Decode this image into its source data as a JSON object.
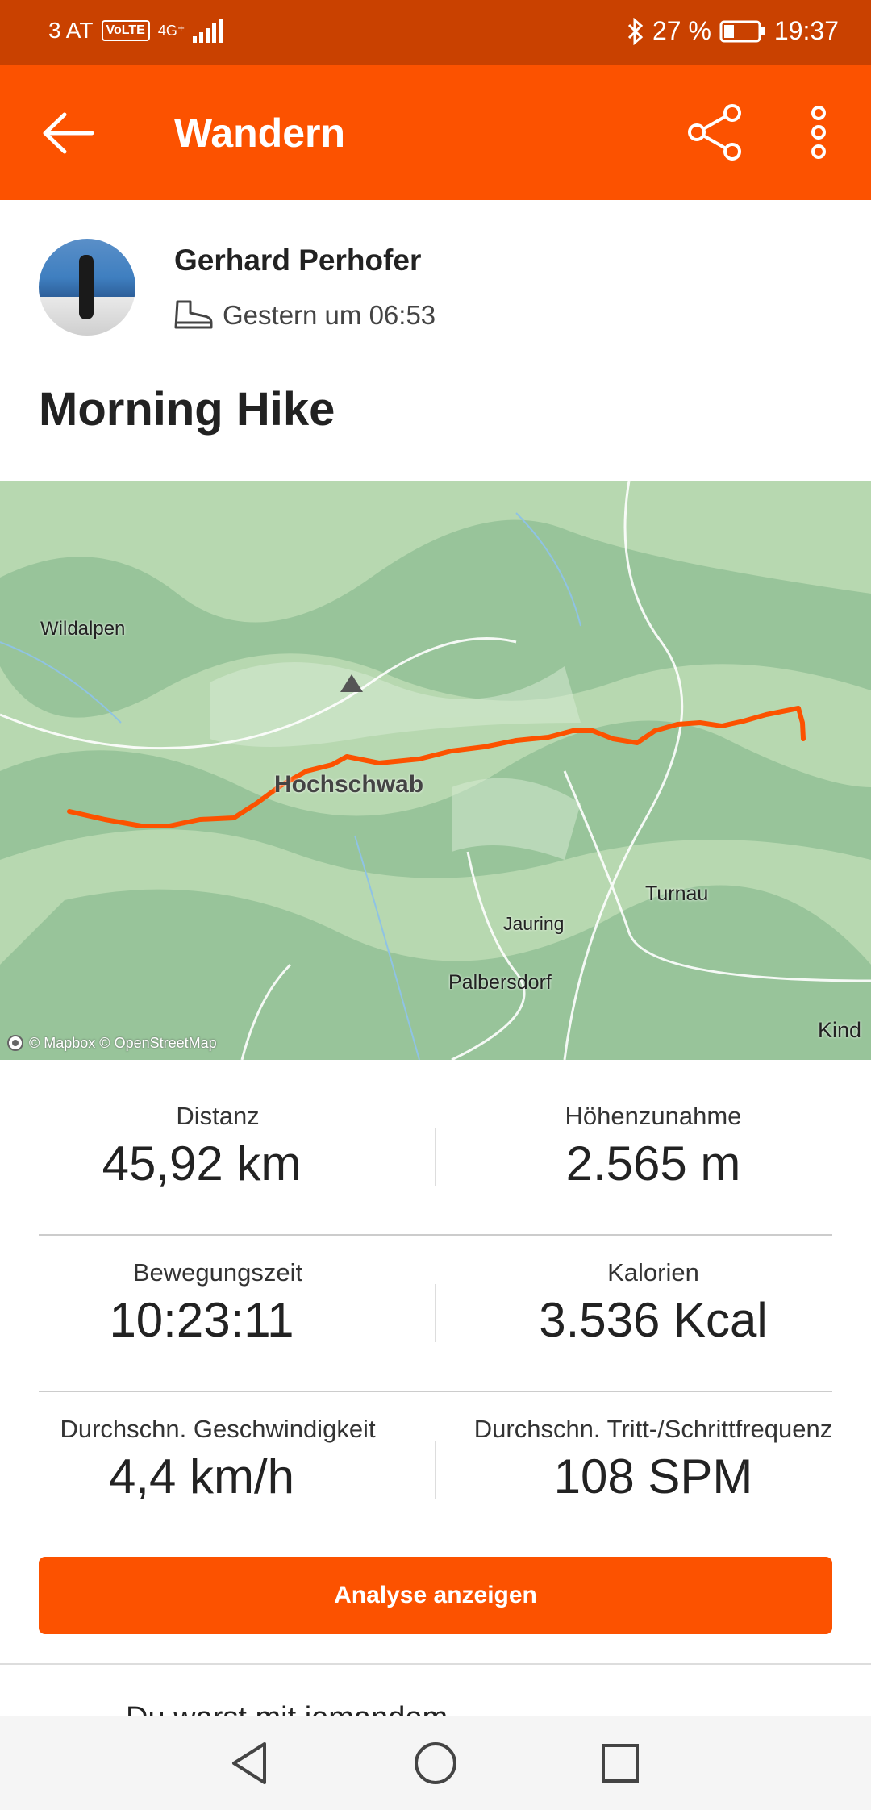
{
  "status_bar": {
    "carrier": "3 AT",
    "volte": "VoLTE",
    "network": "4G⁺",
    "battery": "27 %",
    "time": "19:37"
  },
  "app_bar": {
    "title": "Wandern"
  },
  "athlete": {
    "name": "Gerhard Perhofer",
    "timestamp": "Gestern um 06:53"
  },
  "activity": {
    "title": "Morning Hike"
  },
  "map": {
    "labels": {
      "wildalpen": "Wildalpen",
      "hochschwab": "Hochschwab",
      "turnau": "Turnau",
      "jauring": "Jauring",
      "palbersdorf": "Palbersdorf",
      "kind": "Kind"
    },
    "attribution": "© Mapbox © OpenStreetMap",
    "route_color": "#fc5200"
  },
  "stats": {
    "distance": {
      "label": "Distanz",
      "value": "45,92 km"
    },
    "elevation": {
      "label": "Höhenzunahme",
      "value": "2.565 m"
    },
    "moving_time": {
      "label": "Bewegungszeit",
      "value": "10:23:11"
    },
    "calories": {
      "label": "Kalorien",
      "value": "3.536 Kcal"
    },
    "avg_speed": {
      "label": "Durchschn. Geschwindigkeit",
      "value": "4,4 km/h"
    },
    "avg_cadence": {
      "label": "Durchschn. Tritt-/Schrittfrequenz",
      "value": "108 SPM"
    }
  },
  "analysis_button": "Analyse anzeigen",
  "peek_text": "Du warst mit jemandem",
  "colors": {
    "brand": "#fc5200",
    "status_bar": "#c94100"
  }
}
